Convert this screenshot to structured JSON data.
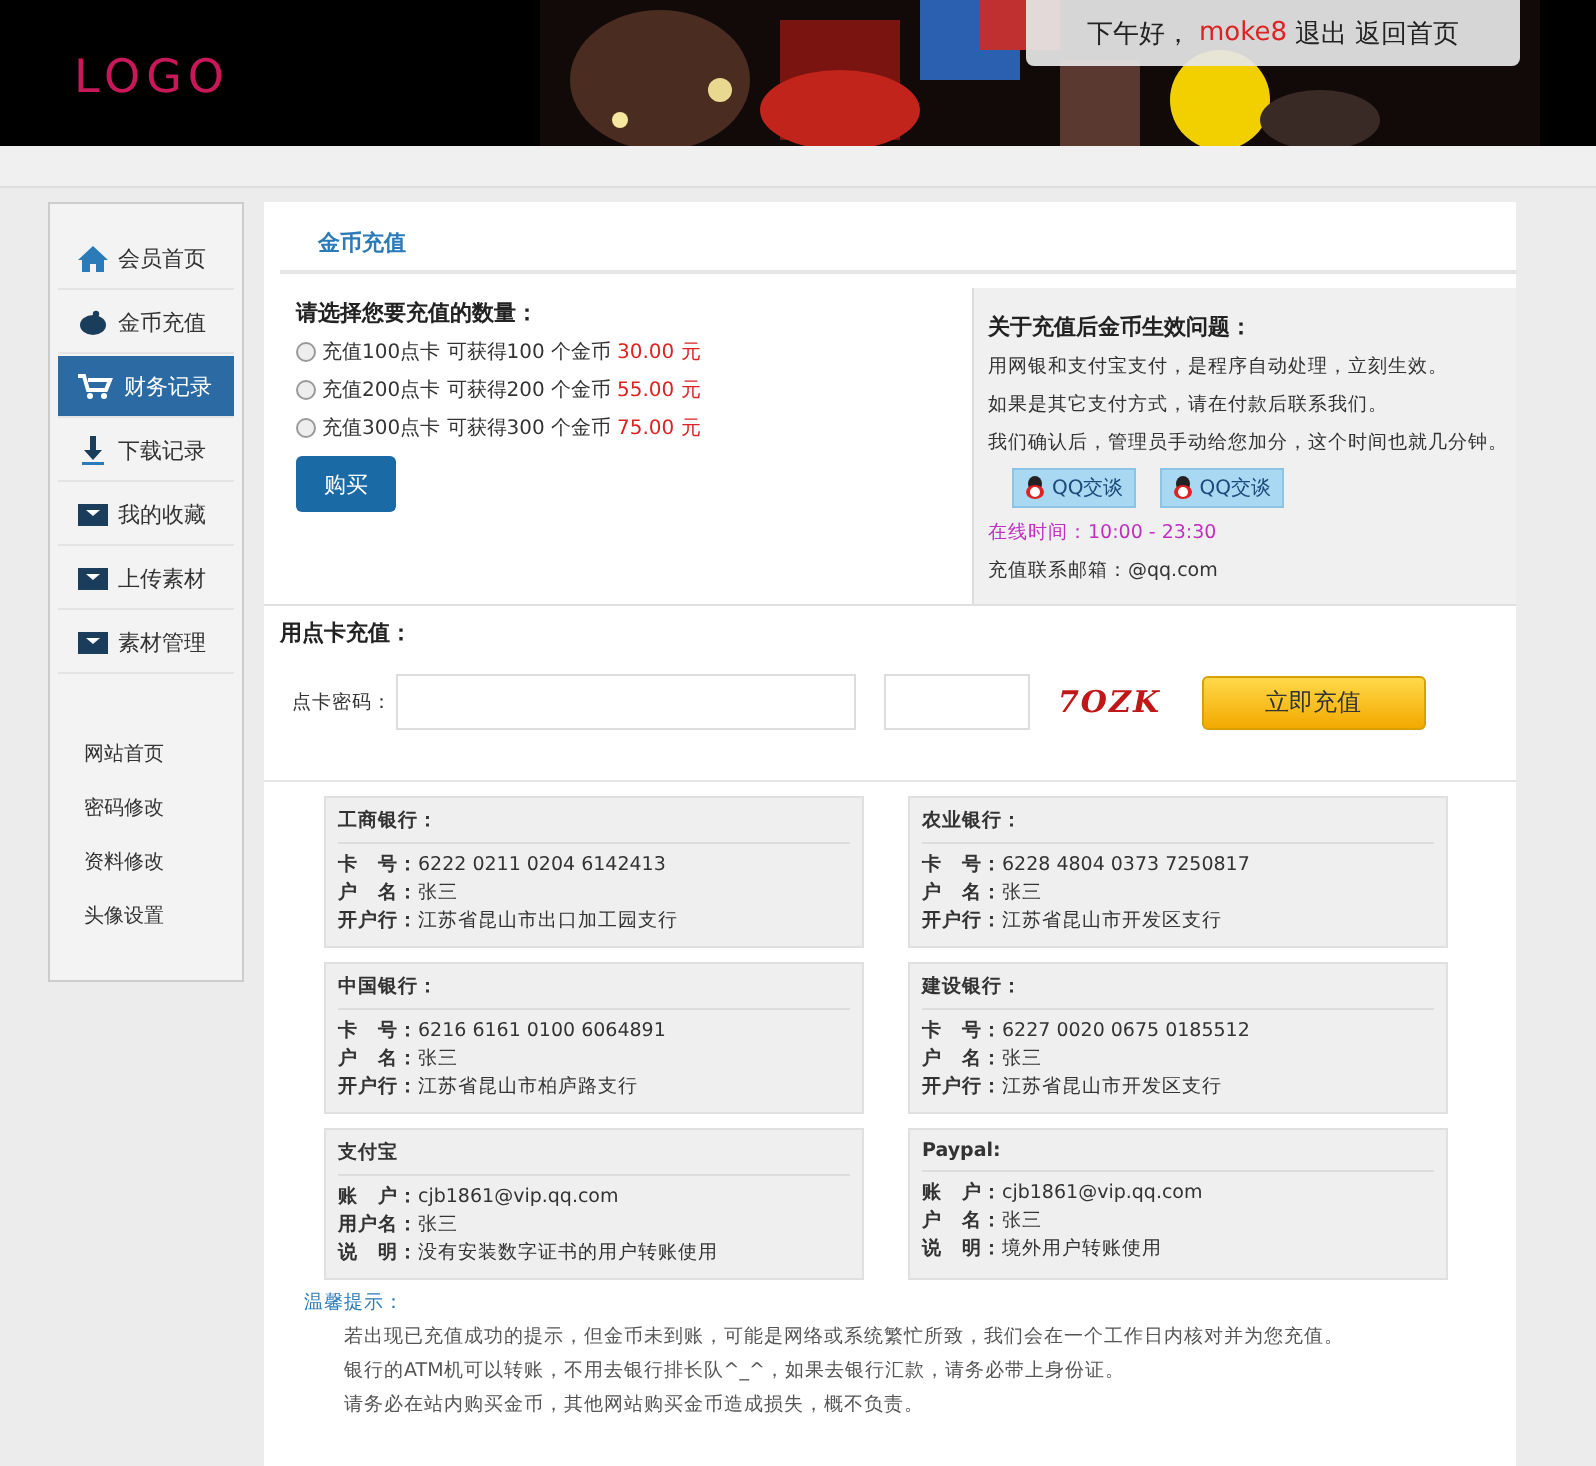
{
  "header": {
    "logo": "LOGO",
    "greeting": "下午好，",
    "username": "moke8",
    "links": [
      "退出",
      "返回首页"
    ]
  },
  "sidebar": {
    "items": [
      {
        "label": "会员首页",
        "selected": false
      },
      {
        "label": "金币充值",
        "selected": false
      },
      {
        "label": "财务记录",
        "selected": true
      },
      {
        "label": "下载记录",
        "selected": false
      },
      {
        "label": "我的收藏",
        "selected": false
      },
      {
        "label": "上传素材",
        "selected": false
      },
      {
        "label": "素材管理",
        "selected": false
      }
    ],
    "links": [
      "网站首页",
      "密码修改",
      "资料修改",
      "头像设置"
    ]
  },
  "section_title": "金币充值",
  "purchase": {
    "heading": "请选择您要充值的数量：",
    "options": [
      {
        "label": "充值100点卡 可获得100 个金币",
        "price": "30.00 元",
        "selected": false
      },
      {
        "label": "充值200点卡 可获得200 个金币",
        "price": "55.00 元",
        "selected": false
      },
      {
        "label": "充值300点卡 可获得300 个金币",
        "price": "75.00 元",
        "selected": false
      }
    ],
    "button": "购买"
  },
  "info": {
    "heading": "关于充值后金币生效问题：",
    "lines": [
      "用网银和支付宝支付，是程序自动处理，立刻生效。",
      "如果是其它支付方式，请在付款后联系我们。",
      "我们确认后，管理员手动给您加分，这个时间也就几分钟。"
    ],
    "qq_buttons": [
      "QQ交谈",
      "QQ交谈"
    ],
    "hours": "在线时间：10:00 - 23:30",
    "email": "充值联系邮箱：@qq.com"
  },
  "card_recharge": {
    "heading": "用点卡充值：",
    "password_label": "点卡密码：",
    "captcha": "7OZK",
    "button": "立即充值"
  },
  "accounts": [
    {
      "title": "工商银行：",
      "rows": [
        [
          "卡　号：",
          "6222 0211 0204 6142413"
        ],
        [
          "户　名：",
          "张三"
        ],
        [
          "开户行：",
          "江苏省昆山市出口加工园支行"
        ]
      ]
    },
    {
      "title": "农业银行：",
      "rows": [
        [
          "卡　号：",
          "6228 4804 0373 7250817"
        ],
        [
          "户　名：",
          "张三"
        ],
        [
          "开户行：",
          "江苏省昆山市开发区支行"
        ]
      ]
    },
    {
      "title": "中国银行：",
      "rows": [
        [
          "卡　号：",
          "6216 6161 0100 6064891"
        ],
        [
          "户　名：",
          "张三"
        ],
        [
          "开户行：",
          "江苏省昆山市柏庐路支行"
        ]
      ]
    },
    {
      "title": "建设银行：",
      "rows": [
        [
          "卡　号：",
          "6227 0020 0675 0185512"
        ],
        [
          "户　名：",
          "张三"
        ],
        [
          "开户行：",
          "江苏省昆山市开发区支行"
        ]
      ]
    },
    {
      "title": "支付宝",
      "rows": [
        [
          "账　户：",
          "cjb1861@vip.qq.com"
        ],
        [
          "用户名：",
          "张三"
        ],
        [
          "说　明：",
          "没有安装数字证书的用户转账使用"
        ]
      ]
    },
    {
      "title": "Paypal:",
      "rows": [
        [
          "账　户：",
          "cjb1861@vip.qq.com"
        ],
        [
          "户　名：",
          "张三"
        ],
        [
          "说　明：",
          "境外用户转账使用"
        ]
      ]
    }
  ],
  "tips": {
    "heading": "温馨提示：",
    "lines": [
      "若出现已充值成功的提示，但金币未到账，可能是网络或系统繁忙所致，我们会在一个工作日内核对并为您充值。",
      "银行的ATM机可以转账，不用去银行排长队^_^，如果去银行汇款，请务必带上身份证。",
      "请务必在站内购买金币，其他网站购买金币造成损失，概不负责。"
    ]
  }
}
